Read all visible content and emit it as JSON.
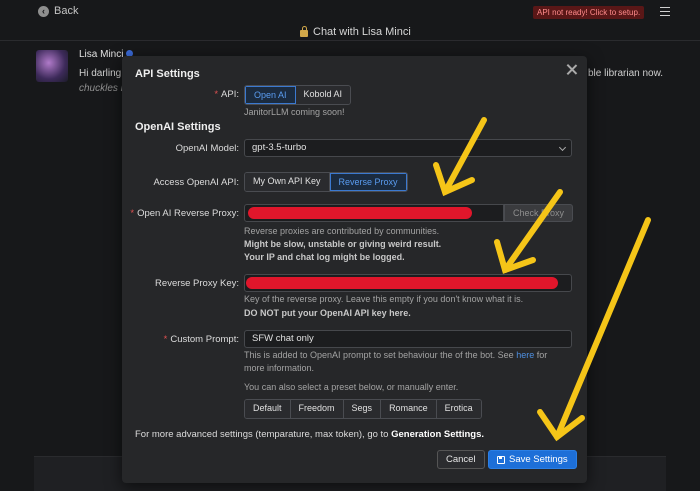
{
  "topbar": {
    "back_label": "Back",
    "api_warning": "API not ready! Click to setup.",
    "chat_title": "Chat with Lisa Minci"
  },
  "chat": {
    "character_name": "Lisa Minci",
    "message_line1_start": "Hi darling,",
    "message_line1_end": "ble librarian now.",
    "message_line2": "chuckles D"
  },
  "modal": {
    "title": "API Settings",
    "api_label": "API:",
    "api_options": [
      "Open AI",
      "Kobold AI"
    ],
    "api_selected": "Open AI",
    "api_note": "JanitorLLM coming soon!",
    "openai_section": "OpenAI Settings",
    "model_label": "OpenAI Model:",
    "model_value": "gpt-3.5-turbo",
    "access_label": "Access OpenAI API:",
    "access_options": [
      "My Own API Key",
      "Reverse Proxy"
    ],
    "access_selected": "Reverse Proxy",
    "proxy_label": "Open AI Reverse Proxy:",
    "check_proxy_label": "Check Proxy",
    "proxy_note_1": "Reverse proxies are contributed by communities.",
    "proxy_note_2": "Might be slow, unstable or giving weird result.",
    "proxy_note_3": "Your IP and chat log might be logged.",
    "proxy_key_label": "Reverse Proxy Key:",
    "proxy_key_note_1": "Key of the reverse proxy. Leave this empty if you don't know what it is.",
    "proxy_key_note_2": "DO NOT put your OpenAI API key here.",
    "custom_prompt_label": "Custom Prompt:",
    "custom_prompt_value": "SFW chat only",
    "prompt_note_1": "This is added to OpenAI prompt to set behaviour the of the bot. See",
    "prompt_note_link": "here",
    "prompt_note_1_end": "for",
    "prompt_note_2": "more information.",
    "preset_note": "You can also select a preset below, or manually enter.",
    "presets": [
      "Default",
      "Freedom",
      "Segs",
      "Romance",
      "Erotica"
    ],
    "advanced_note": "For more advanced settings (temparature, max token), go to",
    "advanced_link": "Generation Settings.",
    "cancel_label": "Cancel",
    "save_label": "Save Settings"
  },
  "colors": {
    "accent": "#1d6fd8",
    "redaction": "#e0162b",
    "annotation_arrow": "#f5c518",
    "required_marker": "#e05151"
  }
}
